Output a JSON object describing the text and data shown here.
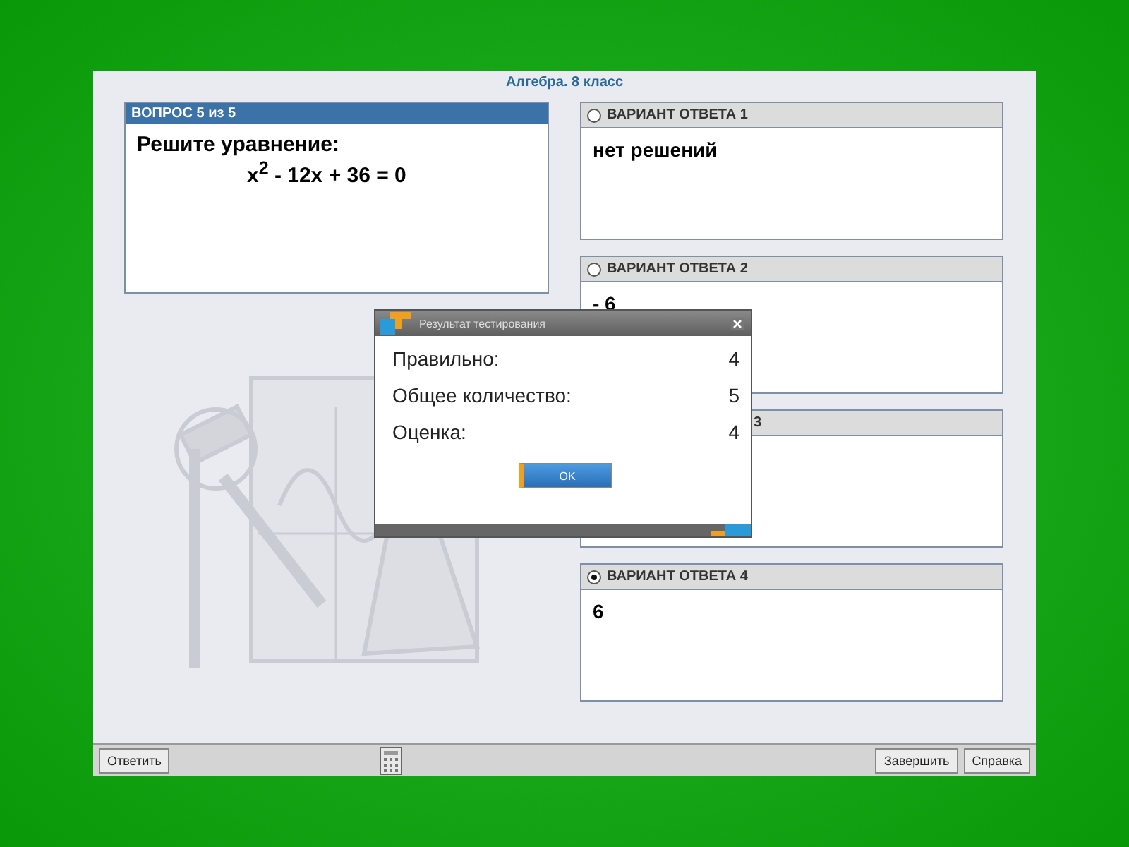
{
  "window": {
    "title": "Алгебра. 8 класс"
  },
  "question": {
    "header": "ВОПРОС 5 из 5",
    "prompt": "Решите уравнение:",
    "equation": "x$^{2}$ - 12x + 36 = 0"
  },
  "answers": [
    {
      "kind": "full",
      "label": "ВАРИАНТ ОТВЕТА 1",
      "text": "нет решений",
      "selected": false
    },
    {
      "kind": "full",
      "label": "ВАРИАНТ ОТВЕТА 2",
      "text": "- 6",
      "selected": false
    },
    {
      "kind": "covered",
      "label": "3"
    },
    {
      "kind": "full",
      "label": "ВАРИАНТ ОТВЕТА 4",
      "text": "6",
      "selected": true
    }
  ],
  "dialog": {
    "title": "Результат тестирования",
    "rows": [
      {
        "label": "Правильно:",
        "value": "4"
      },
      {
        "label": "Общее количество:",
        "value": "5"
      },
      {
        "label": "Оценка:",
        "value": "4"
      }
    ],
    "button": "OK"
  },
  "toolbar": {
    "left_button": "Ответить",
    "right_buttons": [
      "Завершить",
      "Справка"
    ]
  }
}
